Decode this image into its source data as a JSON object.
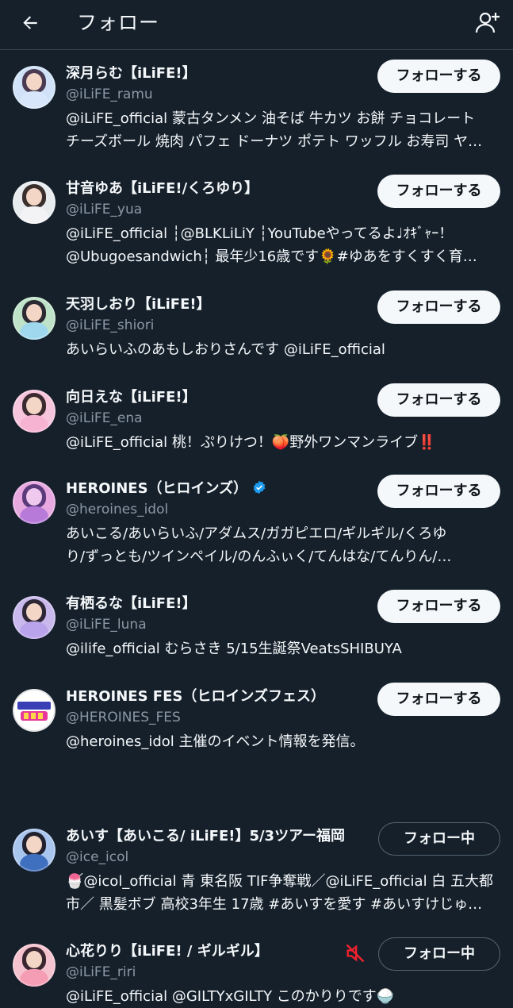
{
  "header": {
    "title": "フォロー",
    "back_icon": "arrow-left-icon",
    "add_icon": "add-user-icon"
  },
  "colors": {
    "background": "#15202b",
    "verified": "#1d9bf0",
    "muted": "#f4212e"
  },
  "users": [
    {
      "name": "深月らむ【iLiFE!】",
      "handle": "@iLiFE_ramu",
      "bio": [
        "@iLiFE_official 蒙古タンメン 油そば 牛カツ お餅 チョコレート",
        "チーズボール 焼肉 パフェ ドーナツ ポテト ワッフル お寿司 ヤ…"
      ],
      "button": "フォローする"
    },
    {
      "name": "甘音ゆあ【iLiFE!/くろゆり】",
      "handle": "@iLiFE_yua",
      "bio": [
        "@iLiFE_official ┆@BLKLiLiY ┆YouTubeやってるよ♩ｵｷﾞｬｰ！",
        "@Ubugoesandwich┆ 最年少16歳です🌻#ゆあをすくすく育…"
      ],
      "button": "フォローする"
    },
    {
      "name": "天羽しおり【iLiFE!】",
      "handle": "@iLiFE_shiori",
      "bio": [
        "あいらいふのあもしおりさんです @iLiFE_official"
      ],
      "button": "フォローする"
    },
    {
      "name": "向日えな【iLiFE!】",
      "handle": "@iLiFE_ena",
      "bio": [
        "@iLiFE_official 桃！ぷりけつ！🍑野外ワンマンライブ‼️"
      ],
      "button": "フォローする"
    },
    {
      "name": "HEROINES（ヒロインズ）",
      "handle": "@heroines_idol",
      "bio": [
        "あいこる/あいらいふ/アダムス/ガガピエロ/ギルギル/くろゆ",
        "り/ずっとも/ツインペイル/のんふぃく/てんはな/てんりん/…"
      ],
      "button": "フォローする",
      "verified": true
    },
    {
      "name": "有栖るな【iLiFE!】",
      "handle": "@iLiFE_luna",
      "bio": [
        "@ilife_official むらさき 5/15生誕祭VeatsSHIBUYA"
      ],
      "button": "フォローする"
    },
    {
      "name": "HEROINES FES（ヒロインズフェス）",
      "handle": "@HEROINES_FES",
      "bio": [
        "@heroines_idol 主催のイベント情報を発信。"
      ],
      "button": "フォローする"
    },
    {
      "name": "あいす【あいこる/ iLiFE!】5/3ツアー福岡",
      "handle": "@ice_icol",
      "bio": [
        "🍧@icol_official 青 東名阪 TIF争奪戦／@iLiFE_official 白 五大都",
        "市／ 黒髪ボブ 高校3年生 17歳 #あいすを愛す #あいすけじゅ…"
      ],
      "button": "フォロー中"
    },
    {
      "name": "心花りり【iLiFE! / ギルギル】",
      "handle": "@iLiFE_riri",
      "bio": [
        "@iLiFE_official @GILTYxGILTY このかりりです🍚"
      ],
      "button": "フォロー中",
      "muted": true
    }
  ]
}
